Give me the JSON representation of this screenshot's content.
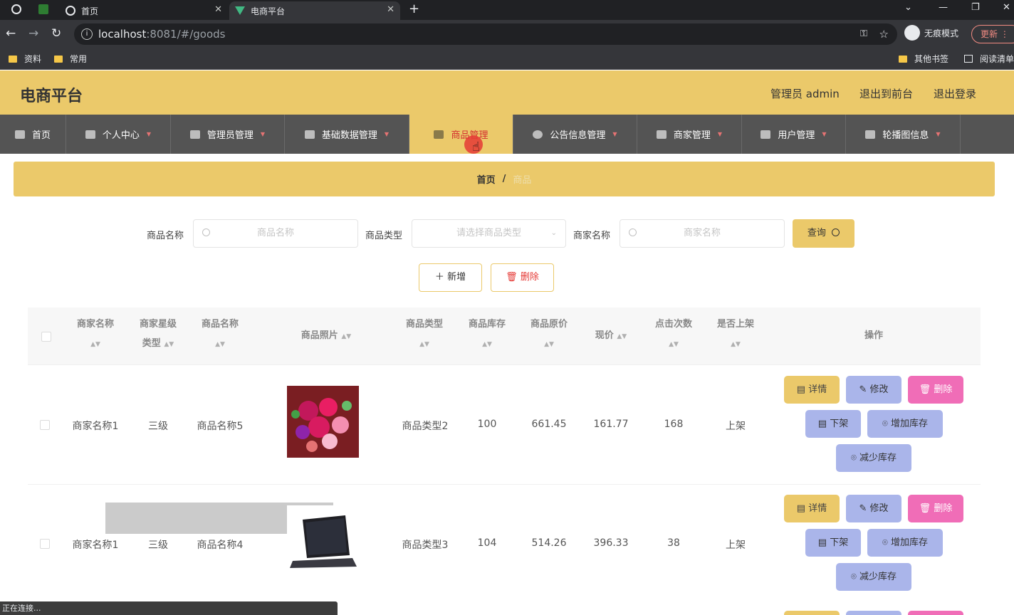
{
  "browser": {
    "tabs": [
      {
        "title": "首页",
        "close": "✕"
      },
      {
        "title": "电商平台",
        "close": "✕"
      }
    ],
    "new_tab": "+",
    "url_host": "localhost",
    "url_path": ":8081/#/goods",
    "incognito_label": "无痕模式",
    "update_label": "更新",
    "bookmarks": [
      "资料",
      "常用"
    ],
    "bookmarks_right": [
      "其他书签",
      "阅读清单"
    ],
    "status_text": "正在连接..."
  },
  "header": {
    "title": "电商平台",
    "admin": "管理员 admin",
    "to_front": "退出到前台",
    "logout": "退出登录"
  },
  "nav": [
    {
      "label": "首页"
    },
    {
      "label": "个人中心"
    },
    {
      "label": "管理员管理"
    },
    {
      "label": "基础数据管理"
    },
    {
      "label": "商品管理"
    },
    {
      "label": "公告信息管理"
    },
    {
      "label": "商家管理"
    },
    {
      "label": "用户管理"
    },
    {
      "label": "轮播图信息"
    }
  ],
  "breadcrumb": {
    "home": "首页",
    "sep": "/",
    "current": "商品"
  },
  "search": {
    "goods_name_label": "商品名称",
    "goods_name_placeholder": "商品名称",
    "goods_type_label": "商品类型",
    "goods_type_placeholder": "请选择商品类型",
    "merchant_label": "商家名称",
    "merchant_placeholder": "商家名称",
    "query_button": "查询"
  },
  "actions": {
    "add": "新增",
    "delete": "删除"
  },
  "table": {
    "headers": {
      "merchant": "商家名称",
      "star_1": "商家星级",
      "star_2": "类型",
      "goods_name": "商品名称",
      "photo": "商品照片",
      "goods_type": "商品类型",
      "stock": "商品库存",
      "orig_price": "商品原价",
      "price": "现价",
      "clicks": "点击次数",
      "on_shelf": "是否上架",
      "ops": "操作"
    },
    "rows": [
      {
        "merchant": "商家名称1",
        "star": "三级",
        "goods_name": "商品名称5",
        "goods_type": "商品类型2",
        "stock": "100",
        "orig_price": "661.45",
        "price": "161.77",
        "clicks": "168",
        "on_shelf": "上架"
      },
      {
        "merchant": "商家名称1",
        "star": "三级",
        "goods_name": "商品名称4",
        "goods_type": "商品类型3",
        "stock": "104",
        "orig_price": "514.26",
        "price": "396.33",
        "clicks": "38",
        "on_shelf": "上架"
      }
    ],
    "row_buttons": {
      "detail": "详情",
      "edit": "修改",
      "delete": "删除",
      "off_shelf": "下架",
      "add_stock": "增加库存",
      "reduce_stock": "减少库存"
    }
  },
  "colors": {
    "accent": "#ebc96a",
    "nav_bg": "#545454",
    "edit": "#aab5ea",
    "delete": "#f06db7"
  }
}
